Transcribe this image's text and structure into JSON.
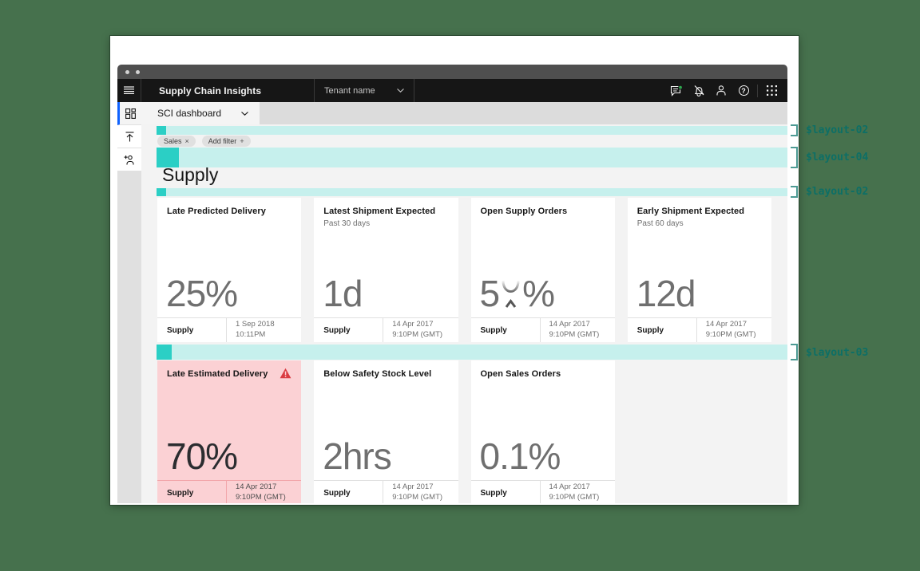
{
  "colors": {
    "canvas_bg": "#46714D",
    "teal_indicator_dark": "#2bcfc5",
    "teal_indicator_light": "#c6f0ed",
    "annotation_text": "#0d6f66",
    "alert_pink_bg": "#fbd1d4",
    "alert_red": "#da3b42",
    "active_nav_blue": "#0f62fe",
    "notification_green": "#2fa84f"
  },
  "annotations": {
    "labels": [
      "$layout-02",
      "$layout-04",
      "$layout-02",
      "$layout-03"
    ]
  },
  "header": {
    "title": "Supply Chain Insights",
    "tenant_label": "Tenant name",
    "help_glyph": "?"
  },
  "toolbar": {
    "dashboard_name": "SCI dashboard"
  },
  "filters": {
    "tag_label": "Sales",
    "tag_dismiss_glyph": "×",
    "add_filter_label": "Add filter",
    "add_filter_glyph": "+"
  },
  "section": {
    "title": "Supply"
  },
  "cards": [
    {
      "title": "Late Predicted Delivery",
      "value": "25%",
      "source": "Supply",
      "date1": "1 Sep 2018",
      "date2": "10:11PM"
    },
    {
      "title": "Latest Shipment Expected",
      "subtitle": "Past 30 days",
      "value": "1d",
      "source": "Supply",
      "date1": "14 Apr 2017",
      "date2": "9:10PM (GMT)"
    },
    {
      "title": "Open Supply Orders",
      "value_prefix": "5",
      "value_suffix": "%",
      "source": "Supply",
      "date1": "14 Apr 2017",
      "date2": "9:10PM (GMT)"
    },
    {
      "title": "Early Shipment Expected",
      "subtitle": "Past 60 days",
      "value": "12d",
      "source": "Supply",
      "date1": "14 Apr 2017",
      "date2": "9:10PM (GMT)"
    },
    {
      "title": "Late Estimated Delivery",
      "value": "70%",
      "source": "Supply",
      "date1": "14 Apr 2017",
      "date2": "9:10PM (GMT)"
    },
    {
      "title": "Below Safety Stock Level",
      "value": "2hrs",
      "source": "Supply",
      "date1": "14 Apr 2017",
      "date2": "9:10PM (GMT)"
    },
    {
      "title": "Open Sales Orders",
      "value": "0.1%",
      "source": "Supply",
      "date1": "14 Apr 2017",
      "date2": "9:10PM (GMT)"
    }
  ]
}
